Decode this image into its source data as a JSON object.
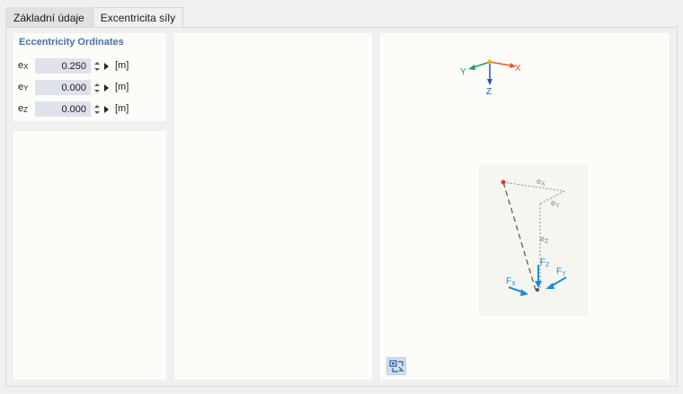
{
  "tabs": [
    {
      "label": "Základní údaje",
      "active": false
    },
    {
      "label": "Excentricita síly",
      "active": true
    }
  ],
  "eccentricity": {
    "title": "Eccentricity Ordinates",
    "rows": [
      {
        "symbol": "e",
        "sub": "X",
        "value": "0.250",
        "unit": "[m]"
      },
      {
        "symbol": "e",
        "sub": "Y",
        "value": "0.000",
        "unit": "[m]"
      },
      {
        "symbol": "e",
        "sub": "Z",
        "value": "0.000",
        "unit": "[m]"
      }
    ]
  },
  "preview": {
    "axes": {
      "x": "X",
      "y": "Y",
      "z": "Z"
    },
    "dims": {
      "ex": "X",
      "ey": "Y",
      "ez": "Z"
    },
    "forces": {
      "fz": "Z",
      "fy": "Y",
      "fx": "X"
    },
    "colors": {
      "axis_x": "#e8572a",
      "axis_y": "#1fa05a",
      "axis_z": "#2358b5",
      "force": "#1a8fd8",
      "point": "#d9402b"
    }
  },
  "toolbar": {
    "view_icon": "view-options-icon"
  }
}
